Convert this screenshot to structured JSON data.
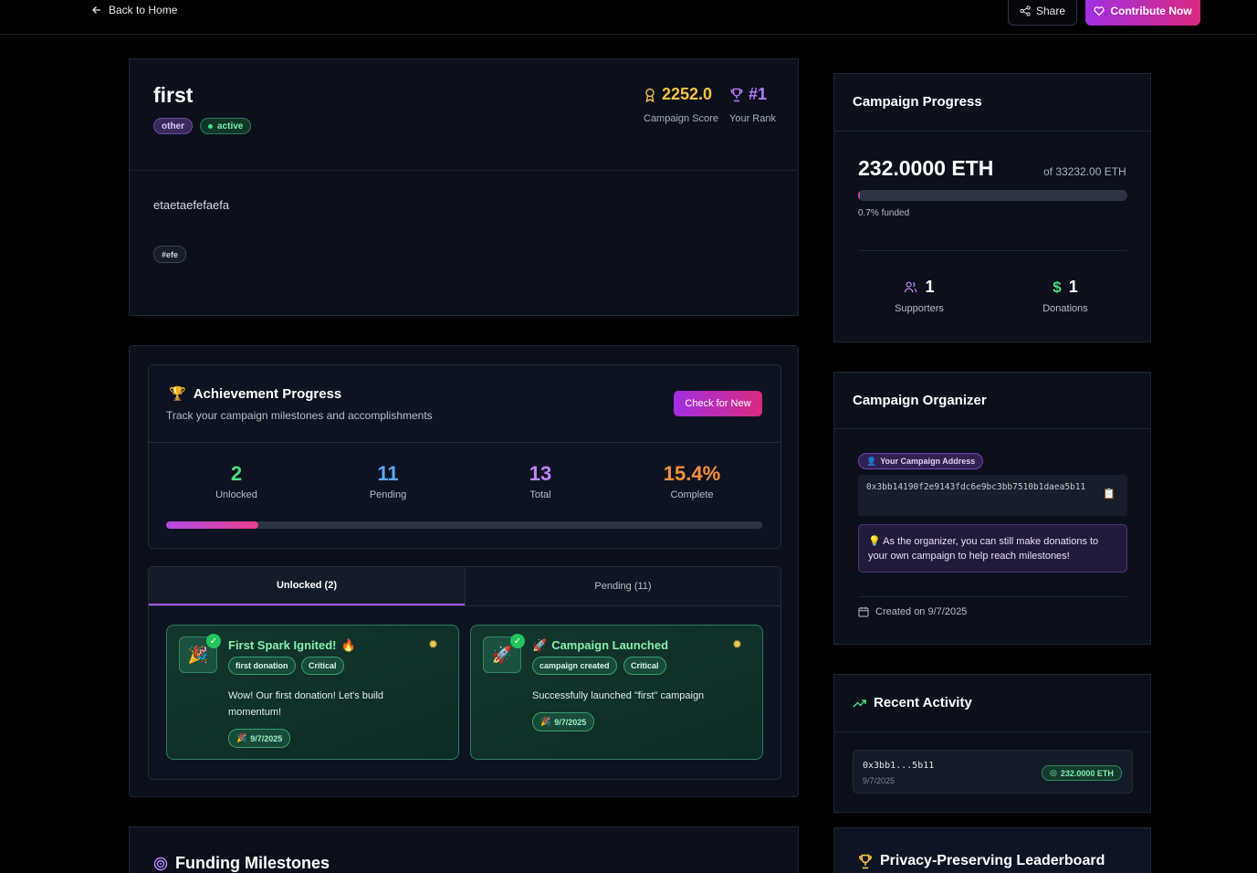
{
  "topbar": {
    "back_label": "Back to Home",
    "share_label": "Share",
    "contribute_label": "Contribute Now"
  },
  "campaign": {
    "title": "first",
    "category": "other",
    "status": "active",
    "score": "2252.0",
    "score_label": "Campaign Score",
    "rank": "#1",
    "rank_label": "Your Rank",
    "description": "etaetaefefaefa",
    "tags": [
      "#efe"
    ]
  },
  "achievements": {
    "title": "Achievement Progress",
    "subtitle": "Track your campaign milestones and accomplishments",
    "check_button": "Check for New",
    "stats": [
      {
        "value": "2",
        "label": "Unlocked",
        "color": "#4ade80"
      },
      {
        "value": "11",
        "label": "Pending",
        "color": "#60a5fa"
      },
      {
        "value": "13",
        "label": "Total",
        "color": "#c084fc"
      },
      {
        "value": "15.4%",
        "label": "Complete",
        "color": "#fb923c"
      }
    ],
    "progress_fraction": 0.154,
    "tabs": [
      "Unlocked (2)",
      "Pending (11)"
    ],
    "cards": [
      {
        "icon": "🎉",
        "name": "First Spark Ignited!",
        "name_emoji": "🔥",
        "chips": [
          "first donation",
          "Critical"
        ],
        "description": "Wow! Our first donation! Let's build momentum!",
        "date": "9/7/2025"
      },
      {
        "icon": "🚀",
        "name": "Campaign Launched",
        "name_emoji": "🚀",
        "chips": [
          "campaign created",
          "Critical"
        ],
        "description": "Successfully launched \"first\" campaign",
        "date": "9/7/2025"
      }
    ]
  },
  "milestones": {
    "title": "Funding Milestones"
  },
  "progress": {
    "title": "Campaign Progress",
    "raised": "232.0000 ETH",
    "goal": "of 33232.00 ETH",
    "funded_fraction": 0.007,
    "funded_label": "0.7% funded",
    "supporters": "1",
    "supporters_label": "Supporters",
    "donations": "1",
    "donations_label": "Donations"
  },
  "organizer": {
    "title": "Campaign Organizer",
    "address_label": "Your Campaign Address",
    "address": "0x3bb14190f2e9143fdc6e9bc3bb7510b1daea5b11",
    "note": "💡 As the organizer, you can still make donations to your own campaign to help reach milestones!",
    "created": "Created on 9/7/2025"
  },
  "activity": {
    "title": "Recent Activity",
    "items": [
      {
        "address": "0x3bb1...5b11",
        "date": "9/7/2025",
        "amount": "232.0000 ETH"
      }
    ]
  },
  "leaderboard": {
    "title": "Privacy-Preserving Leaderboard"
  },
  "colors": {
    "accent_gradient_start": "#a22fe0",
    "accent_gradient_end": "#d8297e",
    "score": "#f6c443",
    "rank": "#b57bff"
  }
}
